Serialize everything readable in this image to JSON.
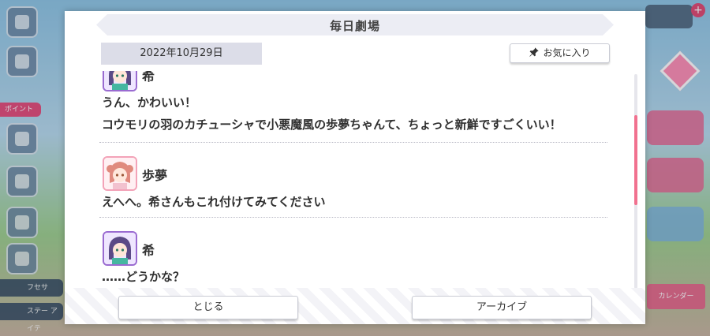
{
  "dialog": {
    "title": "毎日劇場",
    "date": "2022年10月29日",
    "favorite_label": "お気に入り",
    "close_label": "とじる",
    "archive_label": "アーカイブ"
  },
  "messages": [
    {
      "speaker": "希",
      "lines": [
        "うん、かわいい！",
        "コウモリの羽のカチューシャで小悪魔風の歩夢ちゃんて、ちょっと新鮮ですごくいい！"
      ]
    },
    {
      "speaker": "歩夢",
      "lines": [
        "えへへ。希さんもこれ付けてみてください"
      ]
    },
    {
      "speaker": "希",
      "lines": [
        "……どうかな？"
      ]
    }
  ],
  "background": {
    "point_label": "ポイント",
    "ui_labels": [
      "フセサ",
      "ステー アイテ"
    ],
    "calendar_label": "カレンダー"
  },
  "colors": {
    "accent": "#f1718f",
    "title_bar": "#ecedf4",
    "date_tag": "#dcdde8",
    "nozomi_frame": "#9a6bd1",
    "ayumu_frame": "#f3a3b8"
  },
  "icons": [
    "pin-icon",
    "avatar-nozomi",
    "avatar-ayumu"
  ]
}
